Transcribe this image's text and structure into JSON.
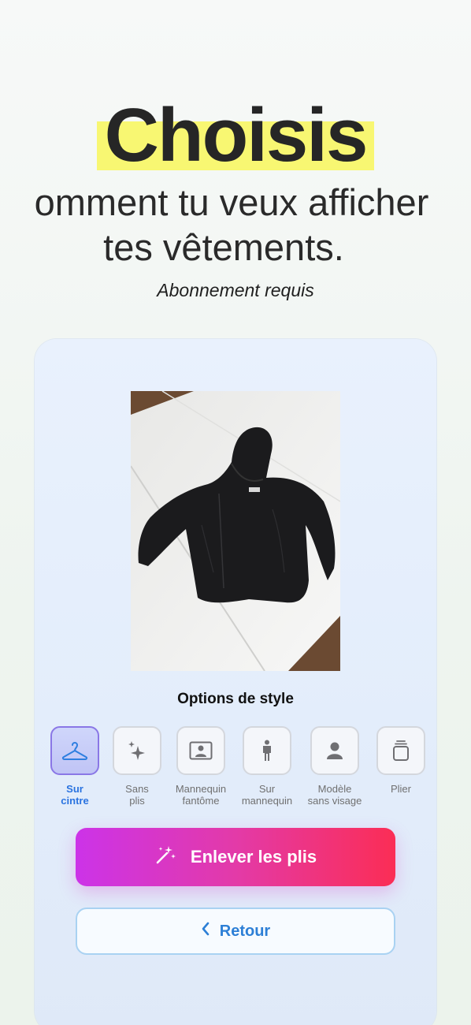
{
  "header": {
    "highlight_word": "Choisis",
    "subtitle_line1": "omment tu veux afficher",
    "subtitle_line2": "tes vêtements.",
    "note": "Abonnement requis"
  },
  "colors": {
    "highlight": "#f8f772",
    "accent_blue": "#2a73e0",
    "gradient_start": "#cc33e8",
    "gradient_end": "#fb2d55"
  },
  "photo": {
    "subject": "black hooded jacket on white table",
    "icon": "clothing-photo"
  },
  "style_options": {
    "title": "Options de style",
    "selected": "Sur cintre",
    "items": [
      {
        "line1": "Sur",
        "line2": "cintre",
        "icon": "hanger-icon"
      },
      {
        "line1": "Sans",
        "line2": "plis",
        "icon": "sparkles-icon"
      },
      {
        "line1": "Mannequin",
        "line2": "fantôme",
        "icon": "ghost-mannequin-icon"
      },
      {
        "line1": "Sur",
        "line2": "mannequin",
        "icon": "mannequin-icon"
      },
      {
        "line1": "Modèle",
        "line2": "sans visage",
        "icon": "faceless-model-icon"
      },
      {
        "line1": "Plier",
        "line2": "",
        "icon": "folded-stack-icon"
      }
    ]
  },
  "actions": {
    "primary_label": "Enlever les plis",
    "primary_icon": "magic-wand-icon",
    "secondary_label": "Retour",
    "secondary_icon": "chevron-left-icon"
  }
}
